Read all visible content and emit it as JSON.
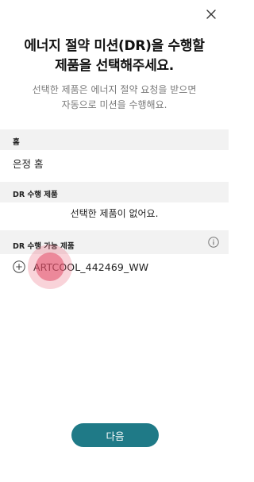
{
  "dialog": {
    "title": "에너지 절약 미션(DR)을 수행할\n제품을 선택해주세요.",
    "subtitle": "선택한 제품은 에너지 절약 요청을 받으면\n자동으로 미션을 수행해요."
  },
  "home_section": {
    "header": "홈",
    "value": "은정 홈"
  },
  "dr_section": {
    "header": "DR 수행 제품",
    "empty_message": "선택한 제품이 없어요."
  },
  "available_section": {
    "header": "DR 수행 가능 제품",
    "items": [
      {
        "name": "ARTCOOL_442469_WW",
        "icon": "add-circle-icon"
      }
    ]
  },
  "footer": {
    "next_label": "다음"
  },
  "colors": {
    "primary_button": "#1f7a87",
    "section_bg": "#f2f2f2",
    "subtitle_text": "#7a7a7a"
  }
}
